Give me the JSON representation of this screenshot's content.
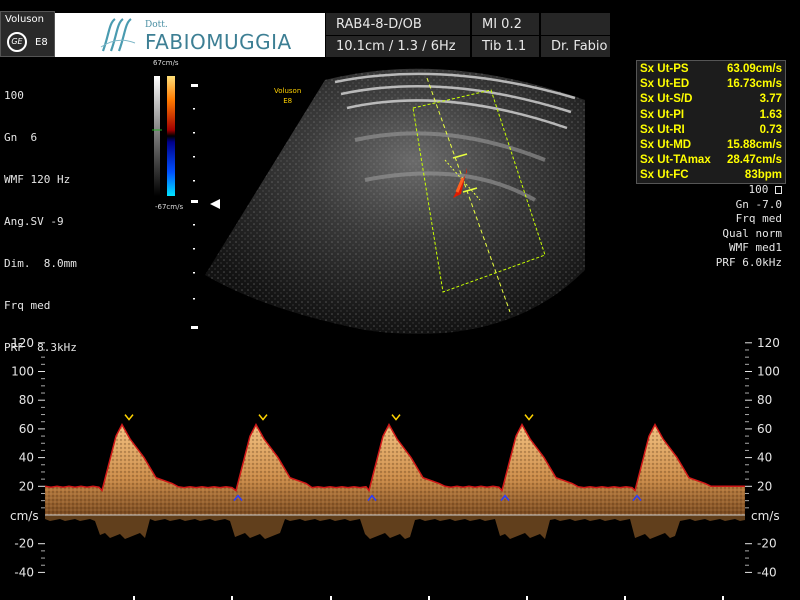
{
  "header": {
    "device": "Voluson",
    "device_model": "E8",
    "ge_logo": "GE",
    "brand_prefix": "Dott.",
    "brand_name": "FABIOMUGGIA",
    "probe": "RAB4-8-D/OB",
    "mi": "MI 0.2",
    "depth_info": "10.1cm / 1.3 /  6Hz",
    "tib": "Tib  1.1",
    "operator": "Dr. Fabio"
  },
  "left_params": [
    "100",
    "Gn  6",
    "WMF 120 Hz",
    "Ang.SV -9",
    "Dim.  8.0mm",
    "Frq med",
    "PRF  8.3kHz"
  ],
  "color_bar": {
    "top": "67cm/s",
    "bottom": "-67cm/s"
  },
  "watermark": {
    "line1": "Voluson",
    "line2": "E8"
  },
  "measurements": [
    {
      "label": "Sx Ut-PS",
      "value": "63.09cm/s"
    },
    {
      "label": "Sx Ut-ED",
      "value": "16.73cm/s"
    },
    {
      "label": "Sx Ut-S/D",
      "value": "3.77"
    },
    {
      "label": "Sx Ut-PI",
      "value": "1.63"
    },
    {
      "label": "Sx Ut-RI",
      "value": "0.73"
    },
    {
      "label": "Sx Ut-MD",
      "value": "15.88cm/s"
    },
    {
      "label": "Sx Ut-TAmax",
      "value": "28.47cm/s"
    },
    {
      "label": "Sx Ut-FC",
      "value": "83bpm"
    }
  ],
  "right_params": [
    "100",
    "Gn -7.0",
    "Frq med",
    "Qual norm",
    "WMF med1",
    "PRF  6.0kHz"
  ],
  "doppler_scale": {
    "unit": "cm/s",
    "ticks": [
      120,
      100,
      80,
      60,
      40,
      20,
      -20,
      -40
    ],
    "baseline_label": "cm/s"
  },
  "colors": {
    "measure_text": "#ffff00",
    "spectrum": "#d9a05a",
    "gate": "#c8ff00",
    "trace": "#d01818"
  }
}
